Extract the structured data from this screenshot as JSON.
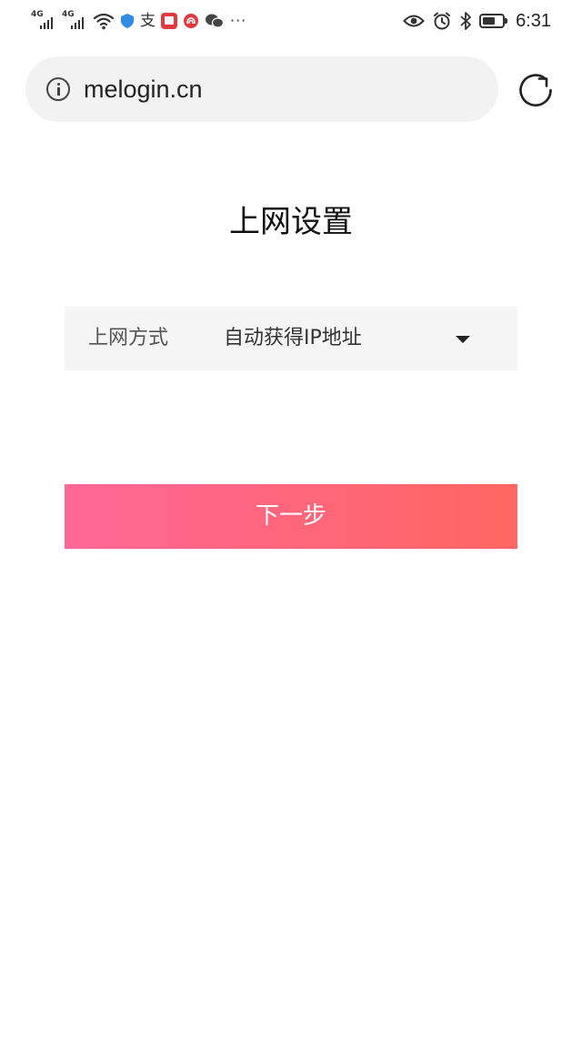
{
  "status_bar": {
    "signal1_label": "4G",
    "signal2_label": "4G",
    "app_glyph": "支",
    "overflow": "···",
    "time": "6:31",
    "icons": [
      "signal-icon",
      "signal-icon",
      "wifi-icon",
      "shield-icon",
      "alipay-icon",
      "book-icon",
      "weibo-icon",
      "wechat-icon",
      "more-icon",
      "eye-icon",
      "alarm-icon",
      "bluetooth-icon",
      "battery-icon"
    ]
  },
  "browser": {
    "url": "melogin.cn",
    "icons": [
      "info-icon",
      "reload-icon"
    ]
  },
  "page": {
    "title": "上网设置",
    "mode_label": "上网方式",
    "mode_value": "自动获得IP地址",
    "next_label": "下一步"
  },
  "colors": {
    "button_gradient_start": "#ff6797",
    "button_gradient_end": "#ff6561",
    "field_bg": "#f5f5f5",
    "address_bg": "#f2f2f2",
    "shield": "#2f8de4",
    "weibo_red": "#e0393e"
  }
}
